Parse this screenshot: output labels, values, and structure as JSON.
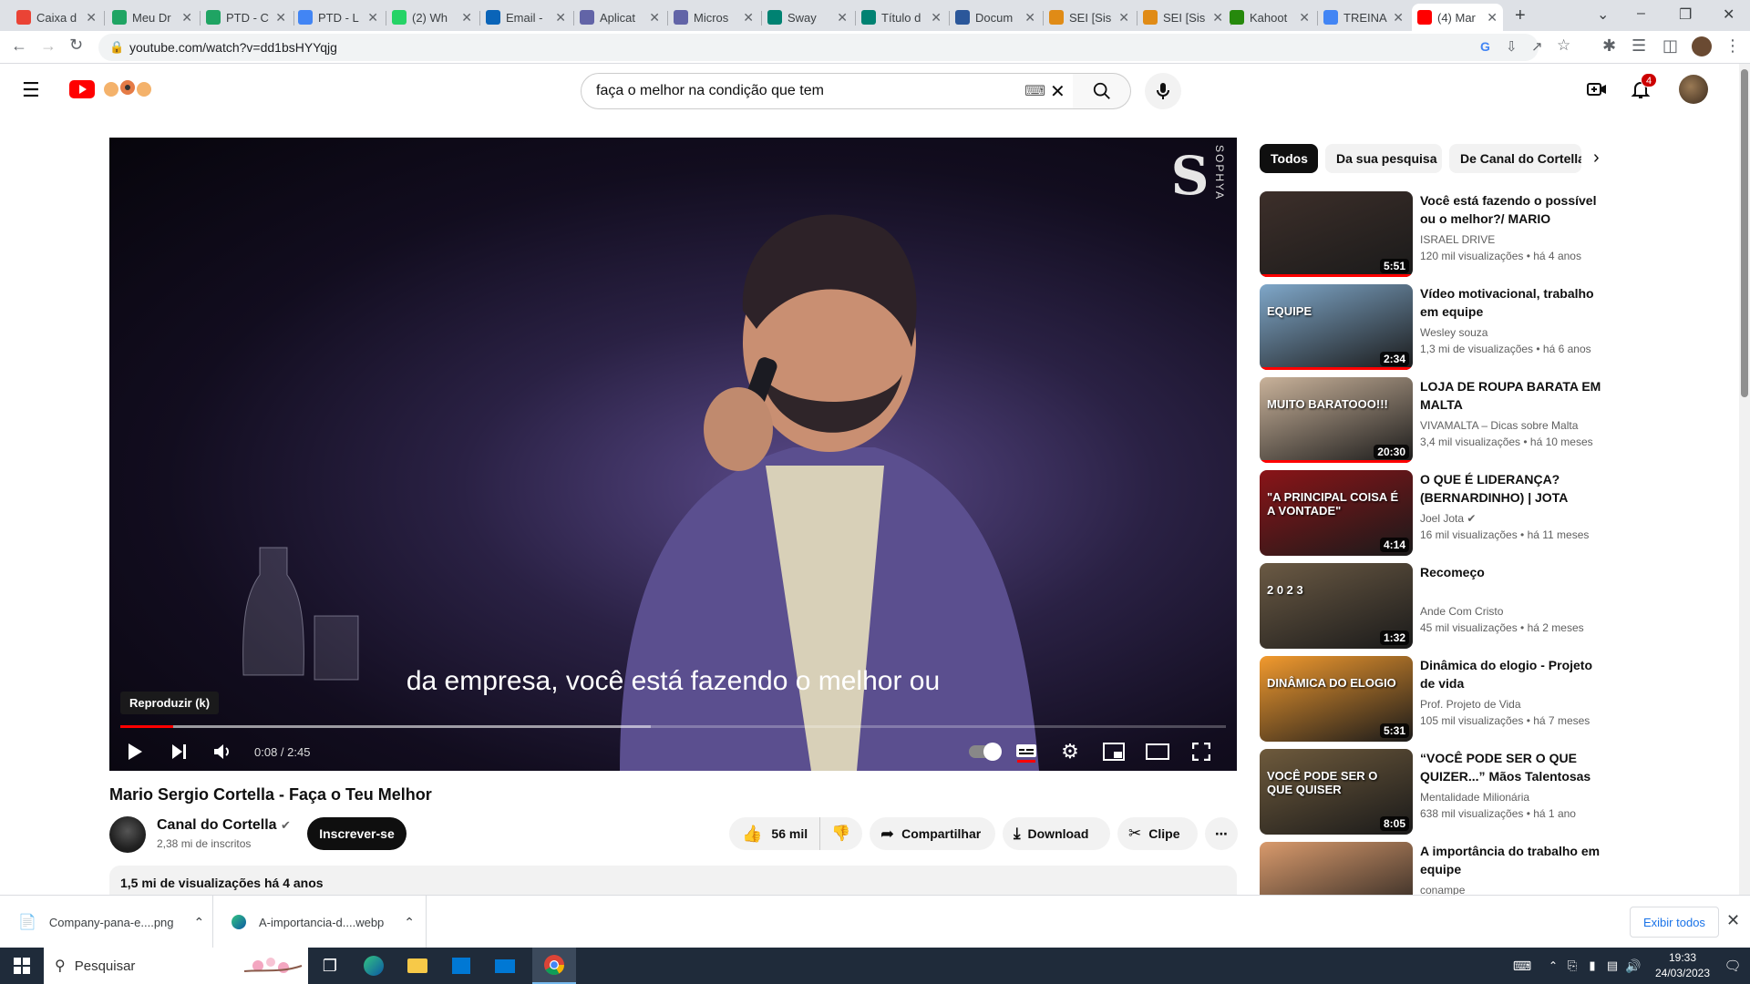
{
  "browser": {
    "tabs": [
      {
        "label": "Caixa d",
        "icon": "gmail-icon",
        "color": "#ea4335"
      },
      {
        "label": "Meu Dr",
        "icon": "drive-icon",
        "color": "#1fa463"
      },
      {
        "label": "PTD - C",
        "icon": "drive-icon",
        "color": "#1fa463"
      },
      {
        "label": "PTD - L",
        "icon": "docs-icon",
        "color": "#4285f4"
      },
      {
        "label": "(2) Wh",
        "icon": "whatsapp-icon",
        "color": "#25d366"
      },
      {
        "label": "Email -",
        "icon": "outlook-icon",
        "color": "#0a64b8"
      },
      {
        "label": "Aplicat",
        "icon": "ms-apps-icon",
        "color": "#6264a7"
      },
      {
        "label": "Micros",
        "icon": "ms-apps-icon",
        "color": "#6264a7"
      },
      {
        "label": "Sway",
        "icon": "sway-icon",
        "color": "#008272"
      },
      {
        "label": "Título d",
        "icon": "sway-icon",
        "color": "#008272"
      },
      {
        "label": "Docum",
        "icon": "word-icon",
        "color": "#2b579a"
      },
      {
        "label": "SEI [Sis",
        "icon": "sei-icon",
        "color": "#e08b16"
      },
      {
        "label": "SEI [Sis",
        "icon": "sei-icon",
        "color": "#e08b16"
      },
      {
        "label": "Kahoot",
        "icon": "kahoot-icon",
        "color": "#26890c"
      },
      {
        "label": "TREINA",
        "icon": "google-icon",
        "color": "#4285f4"
      },
      {
        "label": "(4) Mar",
        "icon": "youtube-icon",
        "color": "#ff0000",
        "active": true
      }
    ],
    "url": "youtube.com/watch?v=dd1bsHYYqjg"
  },
  "youtube": {
    "notification_count": "4",
    "search": {
      "value": "faça o melhor na condição que tem"
    }
  },
  "player": {
    "subtitle": "da empresa, você está fazendo o melhor ou",
    "tooltip": "Reproduzir (k)",
    "time": "0:08 / 2:45",
    "progress_fraction": 0.048,
    "buffered_fraction": 0.48,
    "watermark": "SOPHYA"
  },
  "video": {
    "title": "Mario Sergio Cortella - Faça o Teu Melhor",
    "channel": "Canal do Cortella",
    "subscribers": "2,38 mi de inscritos",
    "subscribe_label": "Inscrever-se",
    "likes": "56 mil",
    "share_label": "Compartilhar",
    "download_label": "Download",
    "clip_label": "Clipe",
    "views_date": "1,5 mi de visualizações  há 4 anos"
  },
  "chips": [
    "Todos",
    "Da sua pesquisa",
    "De Canal do Cortella"
  ],
  "recommendations": [
    {
      "title": "Você está fazendo o possível ou o melhor?/ MARIO SÉRGIO...",
      "channel": "ISRAEL DRIVE",
      "meta": "120 mil visualizações  •  há 4 anos",
      "duration": "5:51",
      "thumb_color": "#3d2f2a",
      "watched": 1.0,
      "verified": false
    },
    {
      "title": "Vídeo motivacional, trabalho em equipe",
      "channel": "Wesley souza",
      "meta": "1,3 mi de visualizações  •  há 6 anos",
      "duration": "2:34",
      "thumb_color": "#7fa7c9",
      "thumb_text": "EQUIPE",
      "watched": 1.0,
      "verified": false
    },
    {
      "title": "LOJA DE ROUPA BARATA EM MALTA",
      "channel": "VIVAMALTA – Dicas sobre Malta",
      "meta": "3,4 mil visualizações  •  há 10 meses",
      "duration": "20:30",
      "thumb_color": "#c9b29a",
      "thumb_text": "MUITO BARATOOO!!!",
      "watched": 1.0,
      "verified": false
    },
    {
      "title": "O QUE É LIDERANÇA? (BERNARDINHO) | JOTA JOTA...",
      "channel": "Joel Jota",
      "meta": "16 mil visualizações  •  há 11 meses",
      "duration": "4:14",
      "thumb_color": "#8a1418",
      "thumb_text": "\"A PRINCIPAL COISA É A VONTADE\"",
      "watched": 0,
      "verified": true
    },
    {
      "title": "Recomeço",
      "channel": "Ande Com Cristo",
      "meta": "45 mil visualizações  •  há 2 meses",
      "duration": "1:32",
      "thumb_color": "#6b5a44",
      "thumb_text": "2 0 2 3",
      "watched": 0,
      "verified": false
    },
    {
      "title": "Dinâmica do elogio - Projeto de vida",
      "channel": "Prof. Projeto de Vida",
      "meta": "105 mil visualizações  •  há 7 meses",
      "duration": "5:31",
      "thumb_color": "#f29a2e",
      "thumb_text": "DINÂMICA DO ELOGIO",
      "watched": 0,
      "verified": false
    },
    {
      "title": "“VOCÊ PODE SER O QUE QUIZER...” Mãos Talentosas A...",
      "channel": "Mentalidade Milionária",
      "meta": "638 mil visualizações  •  há 1 ano",
      "duration": "8:05",
      "thumb_color": "#6e5a3c",
      "thumb_text": "VOCÊ PODE SER O QUE QUISER",
      "watched": 0,
      "verified": false
    },
    {
      "title": "A importância do trabalho em equipe",
      "channel": "conampe",
      "meta": "",
      "duration": "",
      "thumb_color": "#d99a6c",
      "watched": 0,
      "verified": false
    }
  ],
  "downloads": [
    {
      "name": "Company-pana-e....png",
      "icon": "file-icon"
    },
    {
      "name": "A-importancia-d....webp",
      "icon": "edge-icon"
    }
  ],
  "show_all_label": "Exibir todos",
  "taskbar": {
    "search_placeholder": "Pesquisar",
    "time": "19:33",
    "date": "24/03/2023"
  }
}
